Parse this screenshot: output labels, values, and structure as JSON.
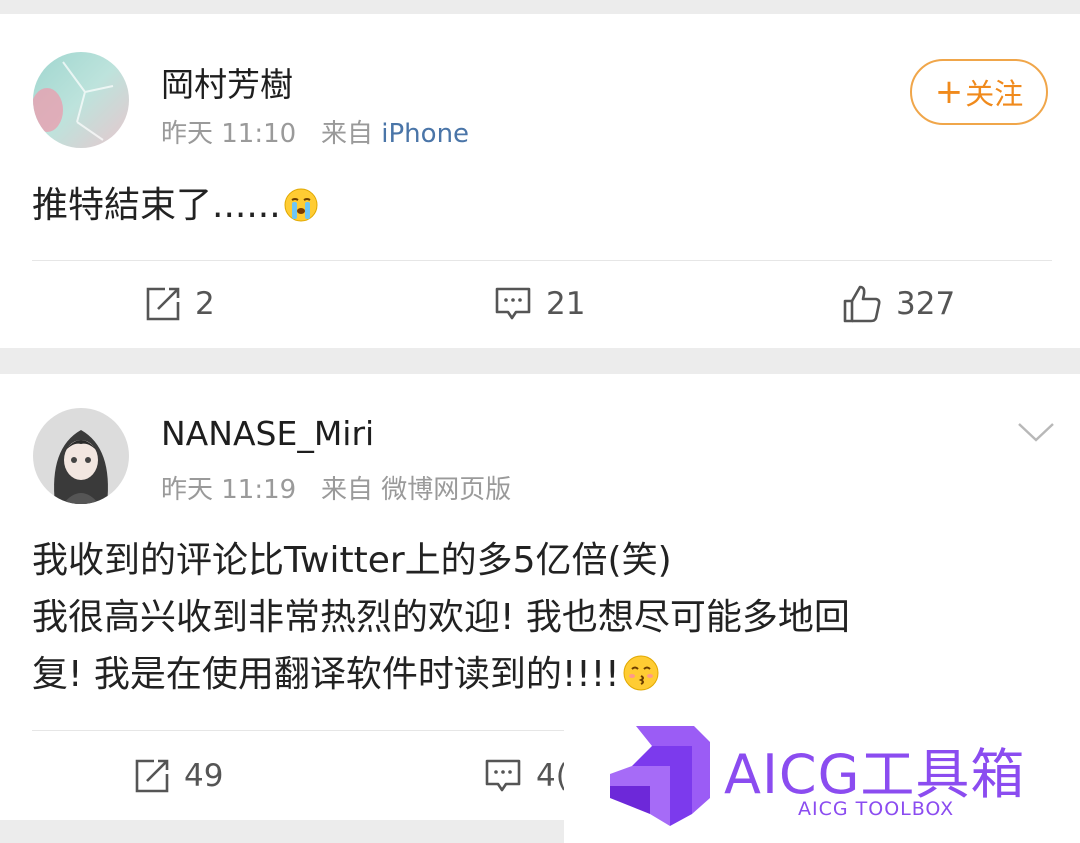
{
  "posts": [
    {
      "username": "岡村芳樹",
      "time": "昨天 11:10",
      "source_prefix": "来自",
      "source": "iPhone",
      "follow_label": "关注",
      "text_lines": [
        "推特結束了......"
      ],
      "emoji": "crying-face",
      "reposts": "2",
      "comments": "21",
      "likes": "327"
    },
    {
      "username": "NANASE_Miri",
      "time": "昨天 11:19",
      "source_prefix": "来自",
      "source": "微博网页版",
      "text_lines": [
        "我收到的评论比Twitter上的多5亿倍(笑)",
        "我很高兴收到非常热烈的欢迎! 我也想尽可能多地回",
        "复! 我是在使用翻译软件时读到的!!!!"
      ],
      "emoji": "kissing-face",
      "reposts": "49",
      "comments": "4("
    }
  ],
  "watermark": {
    "title": "AICG工具箱",
    "subtitle": "AICG TOOLBOX"
  },
  "colors": {
    "accent_orange": "#f08a1c",
    "source_link": "#4a75a8",
    "watermark_purple": "#8b4cf0"
  }
}
